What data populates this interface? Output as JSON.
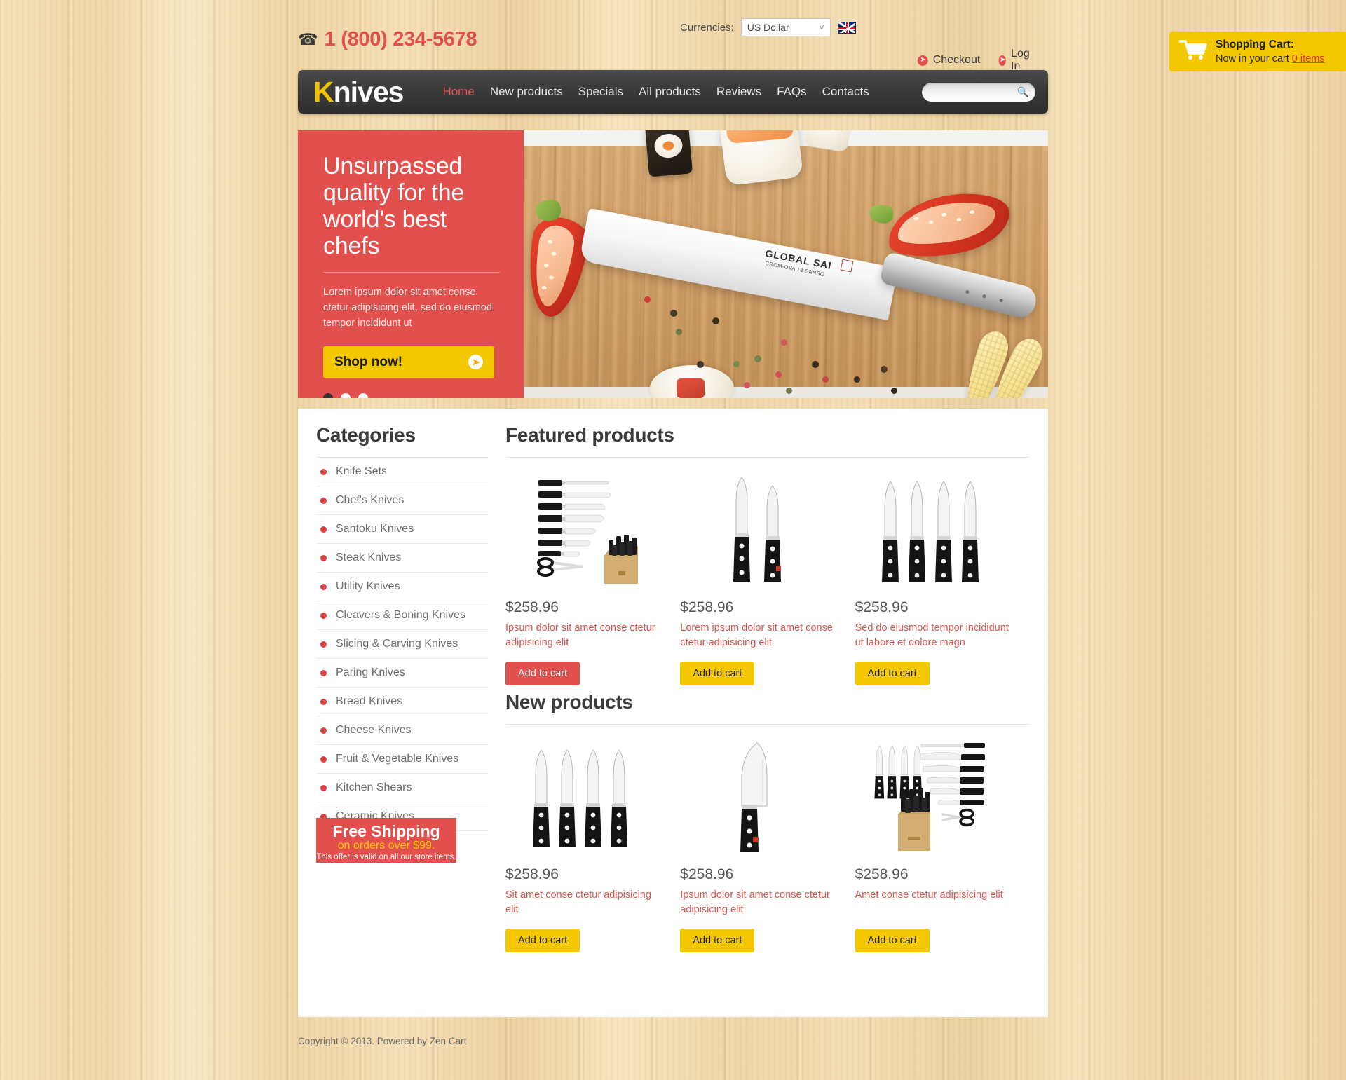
{
  "header": {
    "phone": "1 (800) 234-5678",
    "phone_icon": "phone-icon",
    "currencies_label": "Currencies:",
    "currency_selected": "US Dollar",
    "currency_options": [
      "US Dollar"
    ],
    "flag": "uk-flag-icon",
    "checkout_label": "Checkout",
    "login_label": "Log In",
    "cart": {
      "icon": "shopping-cart-icon",
      "title": "Shopping Cart:",
      "subtitle_prefix": "Now in your cart ",
      "items_link": "0 items"
    }
  },
  "nav": {
    "logo_first": "K",
    "logo_rest": "nives",
    "items": [
      {
        "label": "Home",
        "active": true
      },
      {
        "label": "New products",
        "active": false
      },
      {
        "label": "Specials",
        "active": false
      },
      {
        "label": "All products",
        "active": false
      },
      {
        "label": "Reviews",
        "active": false
      },
      {
        "label": "FAQs",
        "active": false
      },
      {
        "label": "Contacts",
        "active": false
      }
    ],
    "search_placeholder": "",
    "search_value": "",
    "search_icon": "search-icon"
  },
  "hero": {
    "title": "Unsurpassed quality for the world's best chefs",
    "description": "Lorem ipsum dolor sit amet conse ctetur adipisicing elit, sed do eiusmod tempor incididunt ut",
    "button_label": "Shop now!",
    "button_icon": "arrow-right-icon",
    "slide_count": 3,
    "active_slide": 1,
    "image_alt": "Global Sai chef knife on bamboo cutting board with sushi, red peppers, peppercorns and baby corn",
    "knife_brand": "GLOBAL SAI",
    "knife_sub": "CROM-OVA 18 SANSO"
  },
  "sidebar": {
    "title": "Categories",
    "categories": [
      {
        "label": "Knife Sets"
      },
      {
        "label": "Chef's Knives"
      },
      {
        "label": "Santoku Knives"
      },
      {
        "label": "Steak Knives"
      },
      {
        "label": "Utility Knives"
      },
      {
        "label": "Cleavers & Boning Knives"
      },
      {
        "label": "Slicing & Carving Knives"
      },
      {
        "label": "Paring Knives"
      },
      {
        "label": "Bread Knives"
      },
      {
        "label": "Cheese Knives"
      },
      {
        "label": "Fruit & Vegetable Knives"
      },
      {
        "label": "Kitchen Shears"
      },
      {
        "label": "Ceramic Knives"
      }
    ],
    "promo": {
      "line1": "Free Shipping",
      "line2": "on orders over $99.",
      "line3": "This offer is valid on all our store items."
    }
  },
  "featured": {
    "title": "Featured products",
    "products": [
      {
        "price": "$258.96",
        "description": "Ipsum dolor sit amet conse ctetur adipisicing elit",
        "button_label": "Add to cart",
        "button_state": "hover",
        "image_alt": "Eight-piece knife set with wooden block"
      },
      {
        "price": "$258.96",
        "description": "Lorem ipsum dolor sit amet conse ctetur adipisicing elit",
        "button_label": "Add to cart",
        "button_state": "default",
        "image_alt": "Two paring knives with riveted black handles"
      },
      {
        "price": "$258.96",
        "description": "Sed do eiusmod tempor incididunt ut labore et dolore magn",
        "button_label": "Add to cart",
        "button_state": "default",
        "image_alt": "Set of four steak knives"
      }
    ]
  },
  "new_products": {
    "title": "New products",
    "products": [
      {
        "price": "$258.96",
        "description": "Sit amet conse ctetur adipisicing elit",
        "button_label": "Add to cart",
        "button_state": "default",
        "image_alt": "Four steak knives with black riveted handles"
      },
      {
        "price": "$258.96",
        "description": "Ipsum dolor sit amet conse ctetur adipisicing elit",
        "button_label": "Add to cart",
        "button_state": "default",
        "image_alt": "Single santoku knife"
      },
      {
        "price": "$258.96",
        "description": "Amet conse ctetur adipisicing elit",
        "button_label": "Add to cart",
        "button_state": "default",
        "image_alt": "Large knife collection with block, shears and steak knives"
      }
    ]
  },
  "footer": {
    "copyright": "Copyright © 2013. Powered by Zen Cart"
  },
  "colors": {
    "accent_red": "#e2504e",
    "accent_yellow": "#f4c800",
    "nav_dark": "#3a3a3a",
    "panel_white": "#ffffff"
  }
}
